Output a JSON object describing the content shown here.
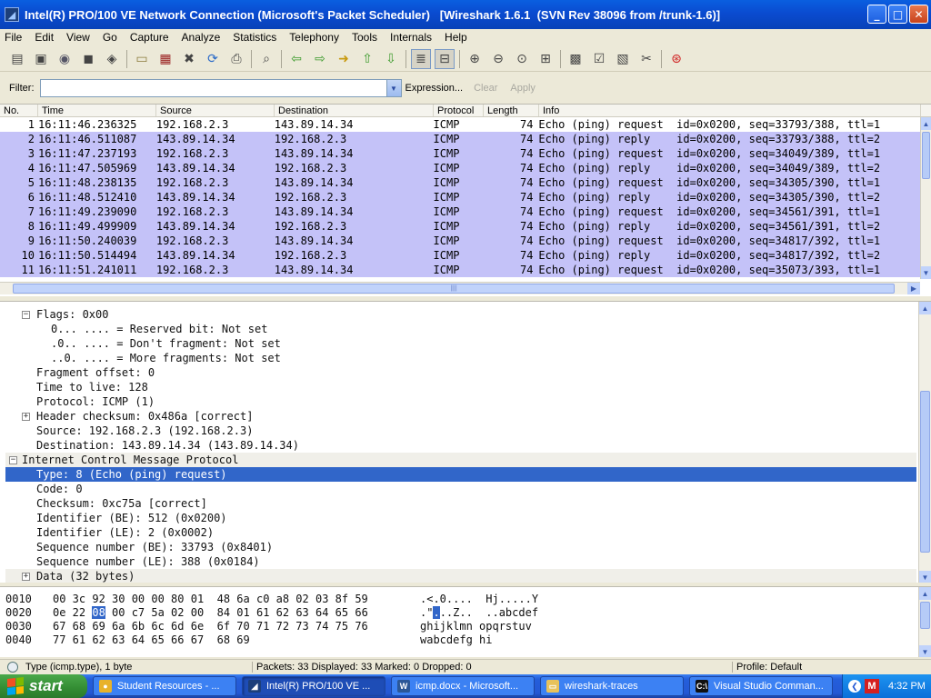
{
  "window": {
    "title": "Intel(R) PRO/100 VE Network Connection (Microsoft's Packet Scheduler)   [Wireshark 1.6.1  (SVN Rev 38096 from /trunk-1.6)]",
    "app_icon_glyph": "◢"
  },
  "menu": [
    "File",
    "Edit",
    "View",
    "Go",
    "Capture",
    "Analyze",
    "Statistics",
    "Telephony",
    "Tools",
    "Internals",
    "Help"
  ],
  "toolbar_icons": [
    "interfaces-icon",
    "options-icon",
    "start-capture-icon",
    "stop-capture-icon",
    "restart-capture-icon",
    "open-file-icon",
    "save-file-icon",
    "close-file-icon",
    "reload-icon",
    "print-icon",
    "find-packet-icon",
    "go-back-icon",
    "go-forward-icon",
    "go-to-packet-icon",
    "go-first-icon",
    "go-last-icon",
    "colorize-icon",
    "autoscroll-icon",
    "zoom-in-icon",
    "zoom-out-icon",
    "normal-size-icon",
    "resize-columns-icon",
    "capture-filters-icon",
    "display-filters-icon",
    "coloring-rules-icon",
    "preferences-icon",
    "help-icon"
  ],
  "filter": {
    "label": "Filter:",
    "value": "",
    "expression": "Expression...",
    "clear": "Clear",
    "apply": "Apply"
  },
  "packet_list": {
    "columns": [
      "No.",
      "Time",
      "Source",
      "Destination",
      "Protocol",
      "Length",
      "Info"
    ],
    "rows": [
      {
        "no": "1",
        "time": "16:11:46.236325",
        "src": "192.168.2.3",
        "dst": "143.89.14.34",
        "proto": "ICMP",
        "len": "74",
        "info": "Echo (ping) request  id=0x0200, seq=33793/388, ttl=1"
      },
      {
        "no": "2",
        "time": "16:11:46.511087",
        "src": "143.89.14.34",
        "dst": "192.168.2.3",
        "proto": "ICMP",
        "len": "74",
        "info": "Echo (ping) reply    id=0x0200, seq=33793/388, ttl=2"
      },
      {
        "no": "3",
        "time": "16:11:47.237193",
        "src": "192.168.2.3",
        "dst": "143.89.14.34",
        "proto": "ICMP",
        "len": "74",
        "info": "Echo (ping) request  id=0x0200, seq=34049/389, ttl=1"
      },
      {
        "no": "4",
        "time": "16:11:47.505969",
        "src": "143.89.14.34",
        "dst": "192.168.2.3",
        "proto": "ICMP",
        "len": "74",
        "info": "Echo (ping) reply    id=0x0200, seq=34049/389, ttl=2"
      },
      {
        "no": "5",
        "time": "16:11:48.238135",
        "src": "192.168.2.3",
        "dst": "143.89.14.34",
        "proto": "ICMP",
        "len": "74",
        "info": "Echo (ping) request  id=0x0200, seq=34305/390, ttl=1"
      },
      {
        "no": "6",
        "time": "16:11:48.512410",
        "src": "143.89.14.34",
        "dst": "192.168.2.3",
        "proto": "ICMP",
        "len": "74",
        "info": "Echo (ping) reply    id=0x0200, seq=34305/390, ttl=2"
      },
      {
        "no": "7",
        "time": "16:11:49.239090",
        "src": "192.168.2.3",
        "dst": "143.89.14.34",
        "proto": "ICMP",
        "len": "74",
        "info": "Echo (ping) request  id=0x0200, seq=34561/391, ttl=1"
      },
      {
        "no": "8",
        "time": "16:11:49.499909",
        "src": "143.89.14.34",
        "dst": "192.168.2.3",
        "proto": "ICMP",
        "len": "74",
        "info": "Echo (ping) reply    id=0x0200, seq=34561/391, ttl=2"
      },
      {
        "no": "9",
        "time": "16:11:50.240039",
        "src": "192.168.2.3",
        "dst": "143.89.14.34",
        "proto": "ICMP",
        "len": "74",
        "info": "Echo (ping) request  id=0x0200, seq=34817/392, ttl=1"
      },
      {
        "no": "10",
        "time": "16:11:50.514494",
        "src": "143.89.14.34",
        "dst": "192.168.2.3",
        "proto": "ICMP",
        "len": "74",
        "info": "Echo (ping) reply    id=0x0200, seq=34817/392, ttl=2"
      },
      {
        "no": "11",
        "time": "16:11:51.241011",
        "src": "192.168.2.3",
        "dst": "143.89.14.34",
        "proto": "ICMP",
        "len": "74",
        "info": "Echo (ping) request  id=0x0200, seq=35073/393, ttl=1"
      }
    ],
    "selected_row": "1",
    "icmp_color": "#c4c2f8"
  },
  "details": {
    "rows": [
      {
        "text": "Flags: 0x00",
        "indent": 1,
        "expander": "minus"
      },
      {
        "text": "0... .... = Reserved bit: Not set",
        "indent": 2
      },
      {
        "text": ".0.. .... = Don't fragment: Not set",
        "indent": 2
      },
      {
        "text": "..0. .... = More fragments: Not set",
        "indent": 2
      },
      {
        "text": "Fragment offset: 0",
        "indent": 1
      },
      {
        "text": "Time to live: 128",
        "indent": 1
      },
      {
        "text": "Protocol: ICMP (1)",
        "indent": 1
      },
      {
        "text": "Header checksum: 0x486a [correct]",
        "indent": 1,
        "expander": "plus"
      },
      {
        "text": "Source: 192.168.2.3 (192.168.2.3)",
        "indent": 1
      },
      {
        "text": "Destination: 143.89.14.34 (143.89.14.34)",
        "indent": 1
      },
      {
        "text": "Internet Control Message Protocol",
        "indent": 0,
        "expander": "minus",
        "style": "hl"
      },
      {
        "text": "Type: 8 (Echo (ping) request)",
        "indent": 1,
        "style": "sel"
      },
      {
        "text": "Code: 0",
        "indent": 1
      },
      {
        "text": "Checksum: 0xc75a [correct]",
        "indent": 1
      },
      {
        "text": "Identifier (BE): 512 (0x0200)",
        "indent": 1
      },
      {
        "text": "Identifier (LE): 2 (0x0002)",
        "indent": 1
      },
      {
        "text": "Sequence number (BE): 33793 (0x8401)",
        "indent": 1
      },
      {
        "text": "Sequence number (LE): 388 (0x0184)",
        "indent": 1
      },
      {
        "text": "Data (32 bytes)",
        "indent": 1,
        "expander": "plus",
        "style": "hl"
      }
    ],
    "selected_color": "#3166c9"
  },
  "bytes": {
    "rows": [
      {
        "off": "0010",
        "hex_before": "00 3c 92 30 00 00 80 01  48 6a c0 a8 02 03 8f 59",
        "hex_sel": "",
        "hex_after": "",
        "ascii_before": ".<.0....  Hj.....Y",
        "ascii_sel": "",
        "ascii_after": ""
      },
      {
        "off": "0020",
        "hex_before": "0e 22 ",
        "hex_sel": "08",
        "hex_after": " 00 c7 5a 02 00  84 01 61 62 63 64 65 66",
        "ascii_before": ".\"",
        "ascii_sel": ".",
        "ascii_after": "..Z..  ..abcdef"
      },
      {
        "off": "0030",
        "hex_before": "67 68 69 6a 6b 6c 6d 6e  6f 70 71 72 73 74 75 76",
        "hex_sel": "",
        "hex_after": "",
        "ascii_before": "ghijklmn opqrstuv",
        "ascii_sel": "",
        "ascii_after": ""
      },
      {
        "off": "0040",
        "hex_before": "77 61 62 63 64 65 66 67  68 69",
        "hex_sel": "",
        "hex_after": "",
        "ascii_before": "wabcdefg hi",
        "ascii_sel": "",
        "ascii_after": ""
      }
    ]
  },
  "status": {
    "field": "Type (icmp.type), 1 byte",
    "packets": "Packets: 33 Displayed: 33 Marked: 0 Dropped: 0",
    "profile": "Profile: Default"
  },
  "taskbar": {
    "start": "start",
    "tasks": [
      {
        "label": "Student Resources - ...",
        "icon": "chrome-icon",
        "color": "#e8b22a",
        "glyph": "●",
        "active": false
      },
      {
        "label": "Intel(R) PRO/100 VE ...",
        "icon": "wireshark-icon",
        "color": "#1d3f7a",
        "glyph": "◢",
        "active": true
      },
      {
        "label": "icmp.docx - Microsoft...",
        "icon": "word-icon",
        "color": "#2b5797",
        "glyph": "W",
        "active": false
      },
      {
        "label": "wireshark-traces",
        "icon": "folder-icon",
        "color": "#e8c25a",
        "glyph": "▭",
        "active": false
      },
      {
        "label": "Visual Studio Comman...",
        "icon": "cmd-icon",
        "color": "#111111",
        "glyph": "C:\\",
        "active": false
      }
    ],
    "clock": "4:32 PM"
  }
}
